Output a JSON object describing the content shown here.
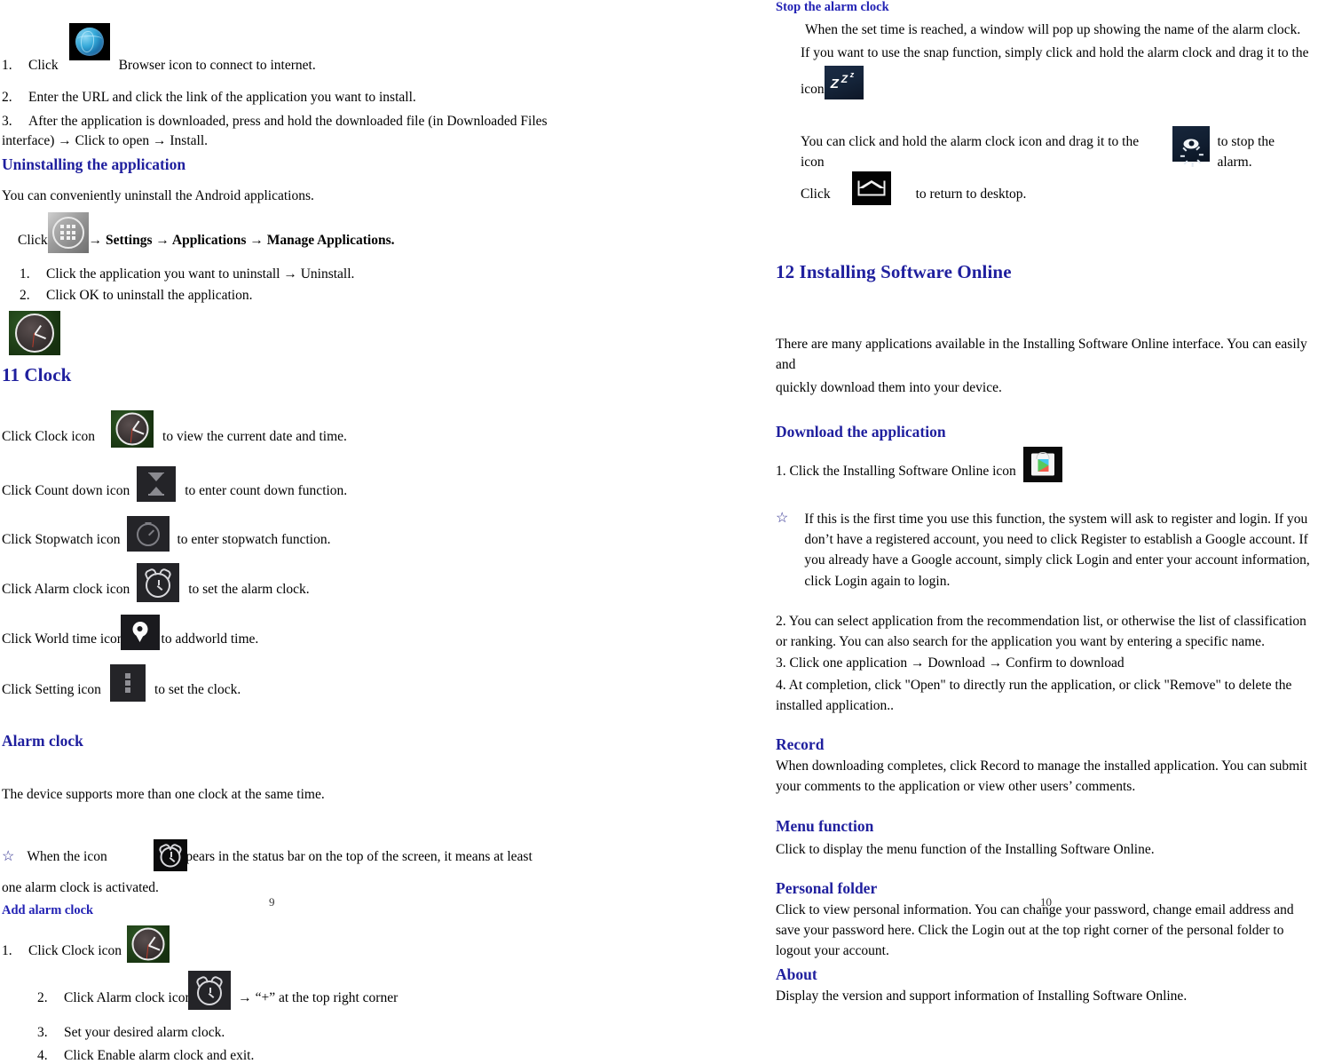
{
  "left_page": {
    "page_number": "9",
    "install_steps": [
      {
        "num": "1.",
        "text_before": "Click",
        "icon": "browser-icon",
        "text_after": "Browser icon to connect to internet."
      },
      {
        "num": "2.",
        "text": "Enter the URL and click the link of the application you want to install."
      },
      {
        "num": "3.",
        "text": "After the application is downloaded, press and hold the downloaded file (in Downloaded Files"
      }
    ],
    "install_step3_cont": "interface) → Click to open → Install.",
    "uninstall_heading": "Uninstalling the application",
    "uninstall_intro": "You can conveniently uninstall the Android applications.",
    "uninstall_click_label": "Click",
    "uninstall_path": "→ Settings → Applications → Manage Applications.",
    "uninstall_steps": [
      {
        "num": "1.",
        "text": "Click the application you want to uninstall → Uninstall."
      },
      {
        "num": "2.",
        "text": "Click OK to uninstall the application."
      }
    ],
    "clock_heading": "11 Clock",
    "clock_lines": [
      {
        "before": "Click Clock icon",
        "icon": "clock-icon",
        "after": "to view the current date and time."
      },
      {
        "before": "Click Count down icon",
        "icon": "hourglass-icon",
        "after": "to enter count down function."
      },
      {
        "before": "Click Stopwatch icon",
        "icon": "stopwatch-icon",
        "after": "to enter stopwatch function."
      },
      {
        "before": "Click Alarm clock icon",
        "icon": "alarm-clock-icon",
        "after": "to set the alarm clock."
      },
      {
        "before": "Click World time icon",
        "icon": "map-pin-icon",
        "after": "to addworld time."
      },
      {
        "before": "Click Setting icon",
        "icon": "overflow-menu-icon",
        "after": "to set the clock."
      }
    ],
    "alarm_heading": "Alarm clock",
    "alarm_intro": "The device supports more than one clock at the same time.",
    "alarm_note_star": "☆",
    "alarm_note_before": "When the icon",
    "alarm_note_after": "appears in the status bar on the top of the screen, it means at least",
    "alarm_note_cont": "one alarm clock is activated.",
    "add_alarm_heading": "Add alarm clock",
    "add_alarm_steps": [
      {
        "num": "1.",
        "text": "Click Clock icon",
        "icon": "clock-icon"
      },
      {
        "num": "2.",
        "text": "Click Alarm clock icon",
        "icon": "alarm-clock-icon",
        "after": "→ “+” at the top right corner"
      },
      {
        "num": "3.",
        "text": "Set your desired alarm clock."
      },
      {
        "num": "4.",
        "text": "Click Enable alarm clock and exit."
      }
    ]
  },
  "right_page": {
    "page_number": "10",
    "stop_alarm_heading": "Stop the alarm clock",
    "stop_alarm_line1": "When the set time is reached, a window will pop up showing the name of the alarm clock.",
    "stop_alarm_line2": "If you want to use the snap function, simply click and hold the alarm clock and drag it to the",
    "stop_alarm_icon_label": "icon",
    "stop_alarm_line3_before": "You can click and hold the alarm clock icon and drag it to the icon",
    "stop_alarm_line3_after": "to stop the alarm.",
    "stop_alarm_line4_before": "Click",
    "stop_alarm_line4_after": "to return to desktop.",
    "installing_heading": "12 Installing Software Online",
    "installing_intro_line1": "There are many applications available in the Installing Software Online interface. You can easily and",
    "installing_intro_line2": "quickly download them into your device.",
    "download_heading": "Download the application",
    "download_step1": "1. Click the Installing Software Online icon",
    "download_note_star": "☆",
    "download_note": "If this is the first time you use this function, the system will ask to register and login. If you don’t have a registered account, you need to click Register to establish a Google account. If you already have a Google account, simply click Login and enter your account information, click Login again to login.",
    "download_step2": "2. You can select application from the recommendation list, or otherwise the list of classification or ranking. You can also search for the application you want by entering a specific name.",
    "download_step3": "3. Click one application → Download → Confirm to download",
    "download_step4": "4. At completion, click \"Open\" to directly run the application, or click \"Remove\" to delete the installed application..",
    "record_heading": "Record",
    "record_text": "When downloading completes, click Record to manage the installed application. You can submit your comments to the application or view other users’ comments.",
    "menu_heading": "Menu function",
    "menu_text": "Click to display the menu function of the Installing Software Online.",
    "personal_heading": "Personal folder",
    "personal_text": "Click to view personal information. You can change your password, change email address and save your password here. Click the Login out at the top right corner of the personal folder to logout your account.",
    "about_heading": "About",
    "about_text": "Display the version and support information of Installing Software Online."
  },
  "colors": {
    "heading_blue": "#1f1f9e",
    "subheading_blue": "#2222b4",
    "text_black": "#000000"
  }
}
